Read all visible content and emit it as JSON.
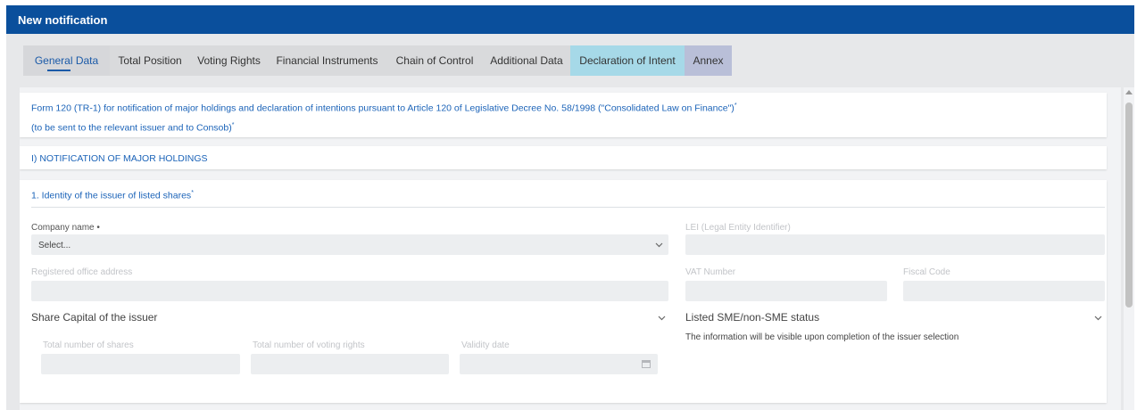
{
  "window": {
    "title": "New notification"
  },
  "tabs": [
    {
      "label": "General Data"
    },
    {
      "label": "Total Position"
    },
    {
      "label": "Voting Rights"
    },
    {
      "label": "Financial Instruments"
    },
    {
      "label": "Chain of Control"
    },
    {
      "label": "Additional Data"
    },
    {
      "label": "Declaration of Intent"
    },
    {
      "label": "Annex"
    }
  ],
  "form_header": {
    "line1": "Form 120 (TR-1) for notification of major holdings and declaration of intentions pursuant to Article 120 of Legislative Decree No. 58/1998 (\"Consolidated Law on Finance\")",
    "line1_mark": "*",
    "line2": "(to be sent to the relevant issuer and to Consob)",
    "line2_mark": "*"
  },
  "section_title": "I) NOTIFICATION OF MAJOR HOLDINGS",
  "issuer": {
    "title": "1. Identity of the issuer of listed shares",
    "title_mark": "*",
    "company_name_label": "Company name •",
    "company_name_value": "Select...",
    "lei_label": "LEI (Legal Entity Identifier)",
    "address_label": "Registered office address",
    "vat_label": "VAT Number",
    "fiscal_label": "Fiscal Code",
    "share_capital_title": "Share Capital of the issuer",
    "total_shares_label": "Total number of shares",
    "total_voting_label": "Total number of voting rights",
    "validity_label": "Validity date",
    "sme_title": "Listed SME/non-SME status",
    "sme_info": "The information will be visible upon completion of the issuer selection"
  },
  "icons": {
    "chevron": "chevron-down-icon",
    "calendar": "calendar-icon",
    "scroll_up": "scroll-up-arrow-icon"
  },
  "colors": {
    "titlebar": "#0a4f9c",
    "accent_text": "#1b63b8",
    "declaration_tab": "#a6d9e8",
    "annex_tab": "#b9bfd8"
  }
}
